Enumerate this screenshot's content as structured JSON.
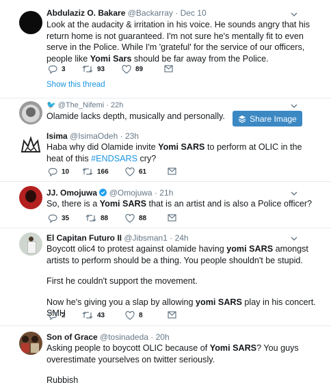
{
  "tweets": [
    {
      "name": "Abdulaziz O. Bakare",
      "handle": "@Backarray",
      "time": "Dec 10",
      "text_1": "Look at the audacity & irritation in his voice. He sounds angry that his return home is not guaranteed. I'm not sure he's mentally fit to even serve in the Police. While I'm 'grateful' for the service of our officers, people like ",
      "text_hl": "Yomi Sars",
      "text_2": " should be far away from the Police.",
      "replies": "3",
      "retweets": "93",
      "likes": "89",
      "show_thread": "Show this thread"
    },
    {
      "retweeter": "@The_Nifemi",
      "time": "22h",
      "text": "Olamide lacks depth, musically and personally.",
      "share_label": "Share Image"
    },
    {
      "name": "Isima",
      "handle": "@IsimaOdeh",
      "time": "23h",
      "text_1": "Haba why did Olamide invite ",
      "text_hl": "Yomi SARS",
      "text_2": " to perform at OLIC in the heat of this ",
      "hashtag": "#ENDSARS",
      "text_3": " cry?",
      "replies": "10",
      "retweets": "166",
      "likes": "61"
    },
    {
      "name": "JJ. Omojuwa",
      "handle": "@Omojuwa",
      "time": "21h",
      "text_1": "So, there is a ",
      "text_hl": "Yomi SARS",
      "text_2": " that is an artist and is also a Police officer?",
      "replies": "35",
      "retweets": "88",
      "likes": "88"
    },
    {
      "name": "El Capitan Futuro II",
      "handle": "@Jibsman1",
      "time": "24h",
      "text_1": "Boycott olic4 to protest against olamide having ",
      "text_hl": "yomi SARS",
      "text_2": " amongst artists to perform should be a thing. You people shouldn't be stupid.",
      "para2": "First he couldn't support the movement.",
      "para3_1": "Now he's giving you a slap by allowing ",
      "para3_hl": "yomi SARS",
      "para3_2": " play in his concert. SMH",
      "replies": "2",
      "retweets": "43",
      "likes": "8"
    },
    {
      "name": "Son of Grace",
      "handle": "@tosinadeda",
      "time": "20h",
      "text_1": "Asking people to boycott OLIC because of ",
      "text_hl": "Yomi SARS",
      "text_2": "? You guys overestimate yourselves on twitter  seriously.",
      "para2": "Rubbish"
    }
  ],
  "colors": {
    "accent": "#1b95e0",
    "share_button": "#3b88c3",
    "verified": "#1da1f2"
  }
}
